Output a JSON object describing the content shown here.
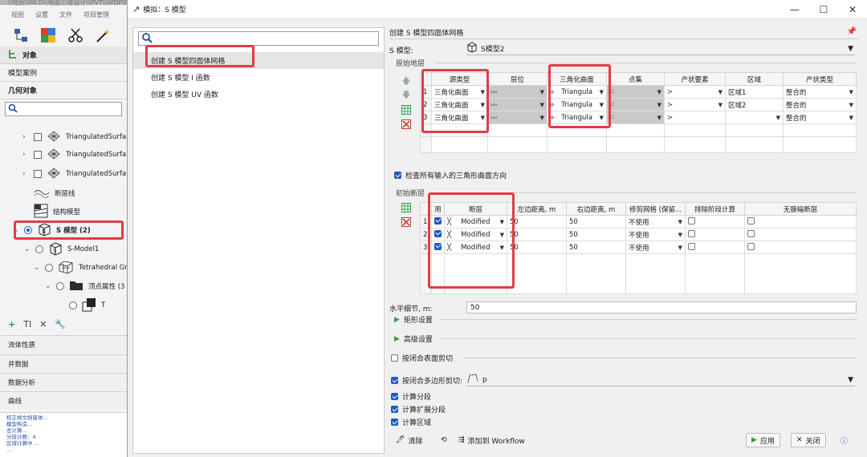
{
  "bg_app": {
    "path_text": "...\\\\地质\\\\MLD\\\\地面三维设计\\\\PVT\\\\WDPS\\\\...",
    "menu": [
      "视图",
      "设置",
      "文件",
      "项目管理"
    ],
    "objects_header": "对象",
    "model_instances": "模型案例",
    "geometry_objects": "几何对象",
    "tree": [
      {
        "label": "TriangulatedSurfa"
      },
      {
        "label": "TriangulatedSurfa"
      },
      {
        "label": "TriangulatedSurfa"
      },
      {
        "label": "断层线"
      },
      {
        "label": "结构模型"
      },
      {
        "label": "S 模型 (2)"
      },
      {
        "label": "S-Model1"
      },
      {
        "label": "Tetrahedral Gr"
      },
      {
        "label": "顶点属性 (3"
      },
      {
        "label": "T"
      }
    ],
    "sections": [
      "流体性质",
      "井数据",
      "数据分析",
      "曲线"
    ],
    "log_lines": [
      "校正帧文档窗体…",
      "模型构造…",
      "总计算…",
      "  分段计数：4",
      "区域计算中 …",
      "  …"
    ]
  },
  "dialog": {
    "title": "模拟：S 模型",
    "controls": {
      "minimize": "—",
      "maximize": "☐",
      "close": "✕"
    },
    "tools": [
      {
        "label": "创建 S 模型四面体网格",
        "selected": true
      },
      {
        "label": "创建 S 模型 I 函数",
        "selected": false
      },
      {
        "label": "创建 S 模型 UV 函数",
        "selected": false
      }
    ],
    "right": {
      "title": "创建 S 模型四面体网格",
      "smodel_label": "S 模型:",
      "smodel_value": "S模型2",
      "orig_layers_title": "原始地层",
      "layers_headers": [
        "源类型",
        "层位",
        "三角化曲面",
        "点集",
        "产状要素",
        "区域",
        "产状类型"
      ],
      "layers_rows": [
        {
          "n": "1",
          "src": "三角化曲面",
          "surface": "Triangula",
          "region": "区域1",
          "attitude": "整合的"
        },
        {
          "n": "2",
          "src": "三角化曲面",
          "surface": "Triangula",
          "region": "区域2",
          "attitude": "整合的"
        },
        {
          "n": "3",
          "src": "三角化曲面",
          "surface": "Triangula",
          "region": "",
          "attitude": "整合的"
        }
      ],
      "check_direction_label": "检查所有输入的三角形曲面方向",
      "faults_title": "初始断层",
      "faults_headers": [
        "用",
        "断层",
        "左边距离, m",
        "右边距离, m",
        "修剪网格 (保留...",
        "排除阶段计算",
        "无振幅断层"
      ],
      "faults_rows": [
        {
          "n": "1",
          "name": "Modified",
          "left": "50",
          "right": "50",
          "trim": "不使用"
        },
        {
          "n": "2",
          "name": "Modified",
          "left": "50",
          "right": "50",
          "trim": "不使用"
        },
        {
          "n": "3",
          "name": "Modified",
          "left": "50",
          "right": "50",
          "trim": "不使用"
        }
      ],
      "horiz_detail_label": "水平细节, m:",
      "horiz_detail_value": "50",
      "rect_settings": "矩形设置",
      "adv_settings": "高级设置",
      "close_surface_cut": "按闭合表面剪切",
      "close_poly_cut": "按闭合多边形剪切:",
      "poly_value": "p",
      "calc_segments": "计算分段",
      "calc_ext_segments": "计算扩展分段",
      "calc_zones": "计算区域"
    },
    "buttons": {
      "clear": "清除",
      "add_workflow": "添加到 Workflow",
      "apply": "应用",
      "close": "关闭"
    }
  }
}
